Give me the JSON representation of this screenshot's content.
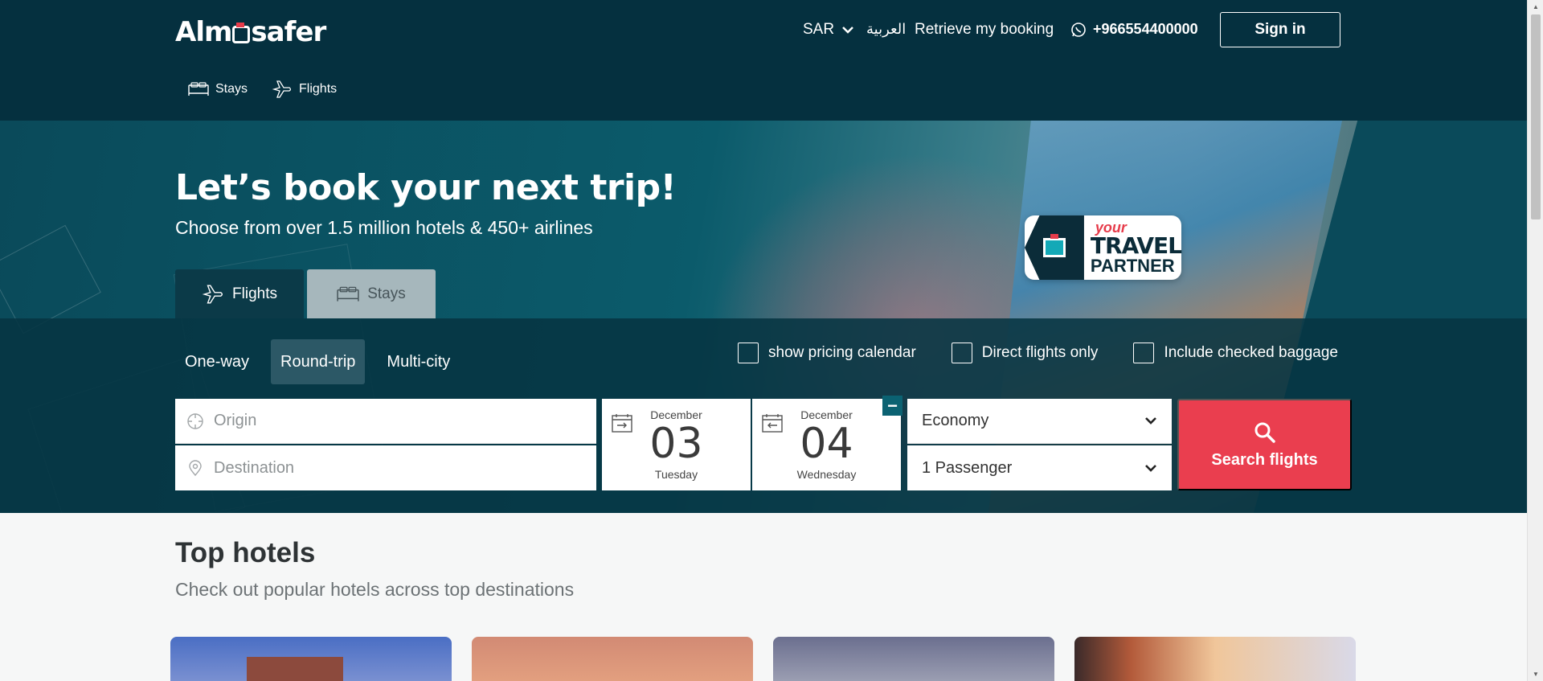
{
  "header": {
    "logo": "Almosafer",
    "currency": "SAR",
    "language": "العربية",
    "retrieve": "Retrieve my booking",
    "phone": "+966554400000",
    "signin": "Sign in",
    "subnav": [
      {
        "label": "Stays",
        "icon": "bed-icon"
      },
      {
        "label": "Flights",
        "icon": "plane-icon"
      }
    ]
  },
  "hero": {
    "title": "Let’s book your next trip!",
    "subtitle": "Choose from over 1.5 million hotels & 450+ airlines",
    "badge": {
      "top": "your",
      "middle": "TRAVEL",
      "bottom": "PARTNER"
    },
    "tabs": [
      {
        "label": "Flights",
        "active": true
      },
      {
        "label": "Stays",
        "active": false
      }
    ]
  },
  "search": {
    "trip_types": [
      "One-way",
      "Round-trip",
      "Multi-city"
    ],
    "selected_trip": "Round-trip",
    "options": [
      "show pricing calendar",
      "Direct flights only",
      "Include checked baggage"
    ],
    "origin_placeholder": "Origin",
    "destination_placeholder": "Destination",
    "depart": {
      "month": "December",
      "day": "03",
      "weekday": "Tuesday"
    },
    "return": {
      "month": "December",
      "day": "04",
      "weekday": "Wednesday"
    },
    "cabin": "Economy",
    "passengers": "1 Passenger",
    "button": "Search flights"
  },
  "top_hotels": {
    "title": "Top hotels",
    "subtitle": "Check out popular hotels across top destinations"
  },
  "colors": {
    "header_bg": "#05303f",
    "accent_red": "#ea3e4f",
    "accent_teal": "#0b6272"
  }
}
